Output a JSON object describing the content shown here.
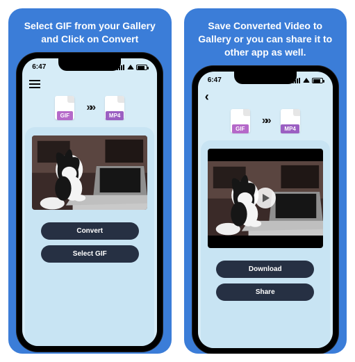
{
  "panels": [
    {
      "caption": "Select GIF from your Gallery and Click on Convert",
      "time": "6:47",
      "nav": "menu",
      "src_tag": "GIF",
      "dst_tag": "MP4",
      "arrows": "»»",
      "media_kind": "image",
      "buttons": [
        "Convert",
        "Select GIF"
      ]
    },
    {
      "caption": "Save Converted Video to Gallery or you can share it to other app as well.",
      "time": "6:47",
      "nav": "back",
      "src_tag": "GIF",
      "dst_tag": "MP4",
      "arrows": "»»",
      "media_kind": "video",
      "buttons": [
        "Download",
        "Share"
      ]
    }
  ]
}
